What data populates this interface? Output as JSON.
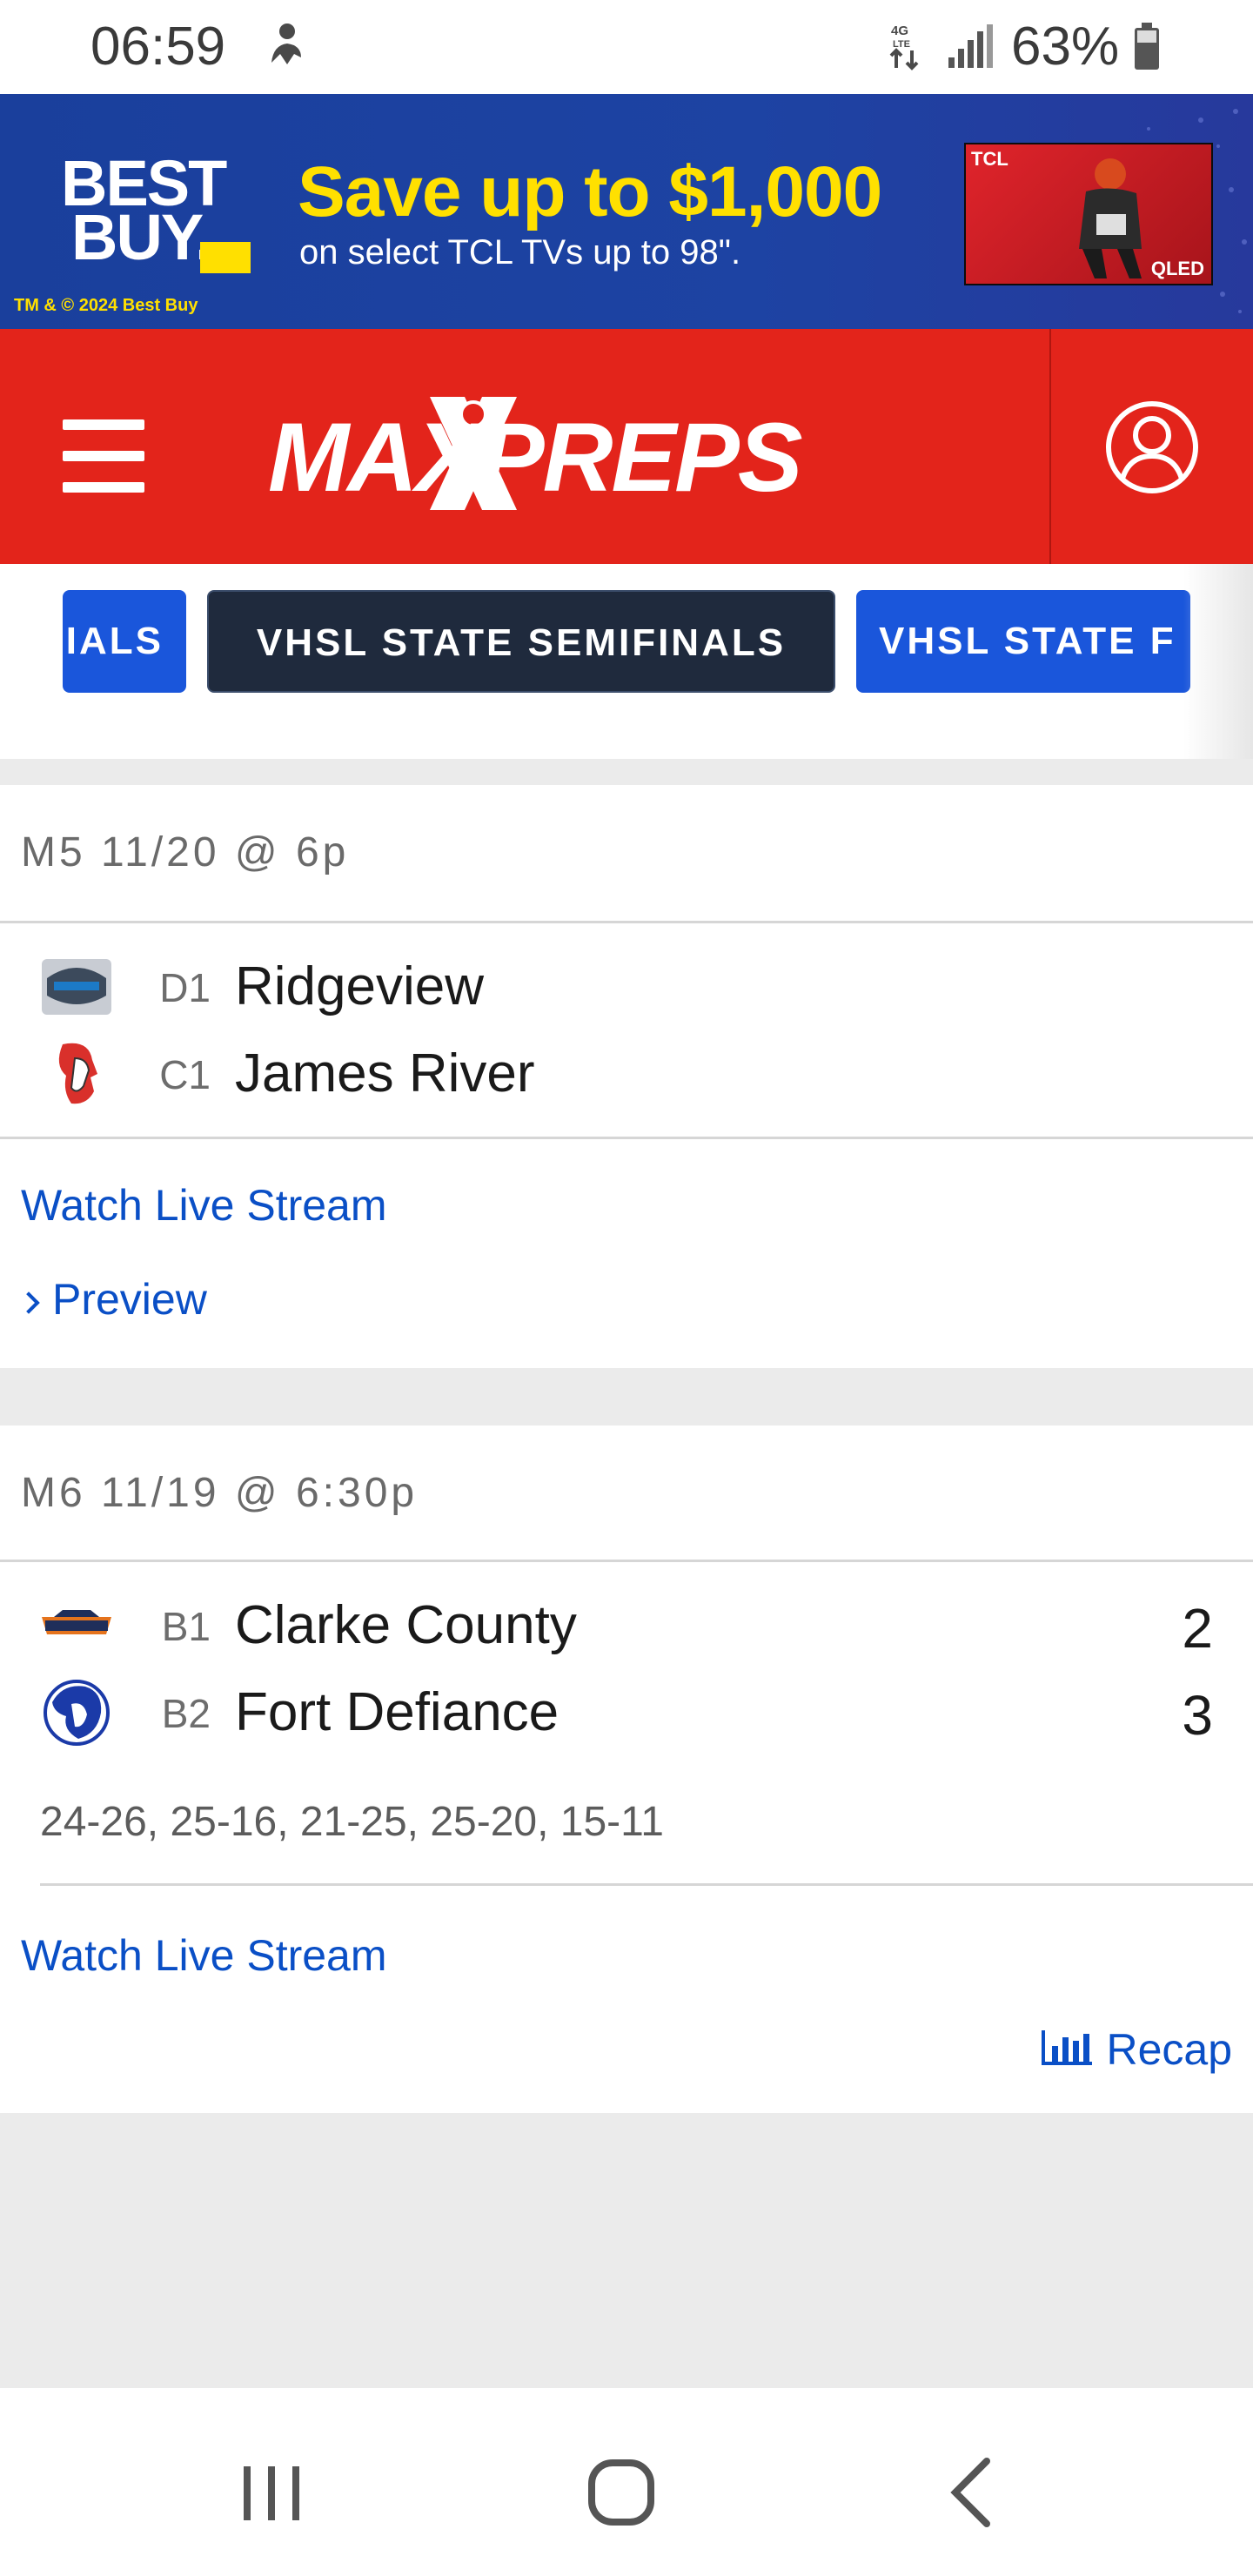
{
  "status_bar": {
    "time": "06:59",
    "network": "4G LTE",
    "battery": "63%"
  },
  "ad": {
    "brand_line1": "BEST",
    "brand_line2": "BUY.",
    "headline": "Save up to $1,000",
    "subline": "on select TCL TVs up to 98\".",
    "copyright": "TM & © 2024 Best Buy",
    "product_brand": "TCL",
    "product_badge": "QLED",
    "colors": {
      "background": "#1d43a3",
      "headline": "#ffe000"
    }
  },
  "header": {
    "logo_text": "MAXPREPS",
    "menu_icon": "hamburger-icon",
    "profile_icon": "user-circle-icon",
    "colors": {
      "background": "#e3241b"
    }
  },
  "tabs": [
    {
      "label": "IALS",
      "active": false
    },
    {
      "label": "VHSL STATE SEMIFINALS",
      "active": true
    },
    {
      "label": "VHSL STATE F",
      "active": false
    }
  ],
  "games": [
    {
      "header": "M5 11/20 @ 6p",
      "teams": [
        {
          "seed": "D1",
          "name": "Ridgeview",
          "score": ""
        },
        {
          "seed": "C1",
          "name": "James River",
          "score": ""
        }
      ],
      "links": {
        "stream": "Watch Live Stream",
        "preview": "Preview"
      }
    },
    {
      "header": "M6 11/19 @ 6:30p",
      "teams": [
        {
          "seed": "B1",
          "name": "Clarke County",
          "score": "2"
        },
        {
          "seed": "B2",
          "name": "Fort Defiance",
          "score": "3"
        }
      ],
      "set_scores": "24-26, 25-16, 21-25, 25-20, 15-11",
      "links": {
        "stream": "Watch Live Stream",
        "recap": "Recap"
      }
    }
  ],
  "nav_bar": {
    "icons": [
      "recent-apps-icon",
      "home-icon",
      "back-icon"
    ]
  },
  "colors": {
    "link": "#0a4fc6",
    "tab_active": "#1f2a3d",
    "tab": "#1a56db"
  }
}
